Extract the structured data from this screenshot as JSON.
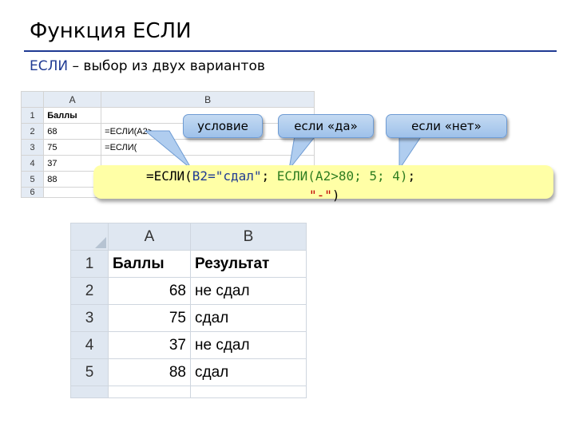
{
  "slide": {
    "title": "Функция ЕСЛИ",
    "subtitle_keyword": "ЕСЛИ",
    "subtitle_rest": " – выбор из двух вариантов"
  },
  "sheet_top": {
    "col_a": "A",
    "col_b": "B",
    "rows": [
      {
        "num": "1",
        "a": "Баллы",
        "b": ""
      },
      {
        "num": "2",
        "a": "68",
        "b": "=ЕСЛИ(A2>"
      },
      {
        "num": "3",
        "a": "75",
        "b": "=ЕСЛИ("
      },
      {
        "num": "4",
        "a": "37",
        "b": ""
      },
      {
        "num": "5",
        "a": "88",
        "b": ""
      },
      {
        "num": "6",
        "a": "",
        "b": ""
      }
    ]
  },
  "callouts": {
    "condition": "условие",
    "if_yes": "если «да»",
    "if_no": "если «нет»"
  },
  "formula": {
    "prefix": "=ЕСЛИ(",
    "condition": "B2=\"сдал\"",
    "sep": "; ",
    "nested": "ЕСЛИ(A2>80; 5; 4)",
    "suffix": ";",
    "else_value": "\"-\"",
    "close": ")"
  },
  "sheet_bottom": {
    "col_a": "A",
    "col_b": "B",
    "header_a": "Баллы",
    "header_b": "Результат",
    "rows": [
      {
        "num": "1",
        "a": "",
        "b": ""
      },
      {
        "num": "2",
        "a": "68",
        "b": "не сдал"
      },
      {
        "num": "3",
        "a": "75",
        "b": "сдал"
      },
      {
        "num": "4",
        "a": "37",
        "b": "не сдал"
      },
      {
        "num": "5",
        "a": "88",
        "b": "сдал"
      }
    ]
  }
}
